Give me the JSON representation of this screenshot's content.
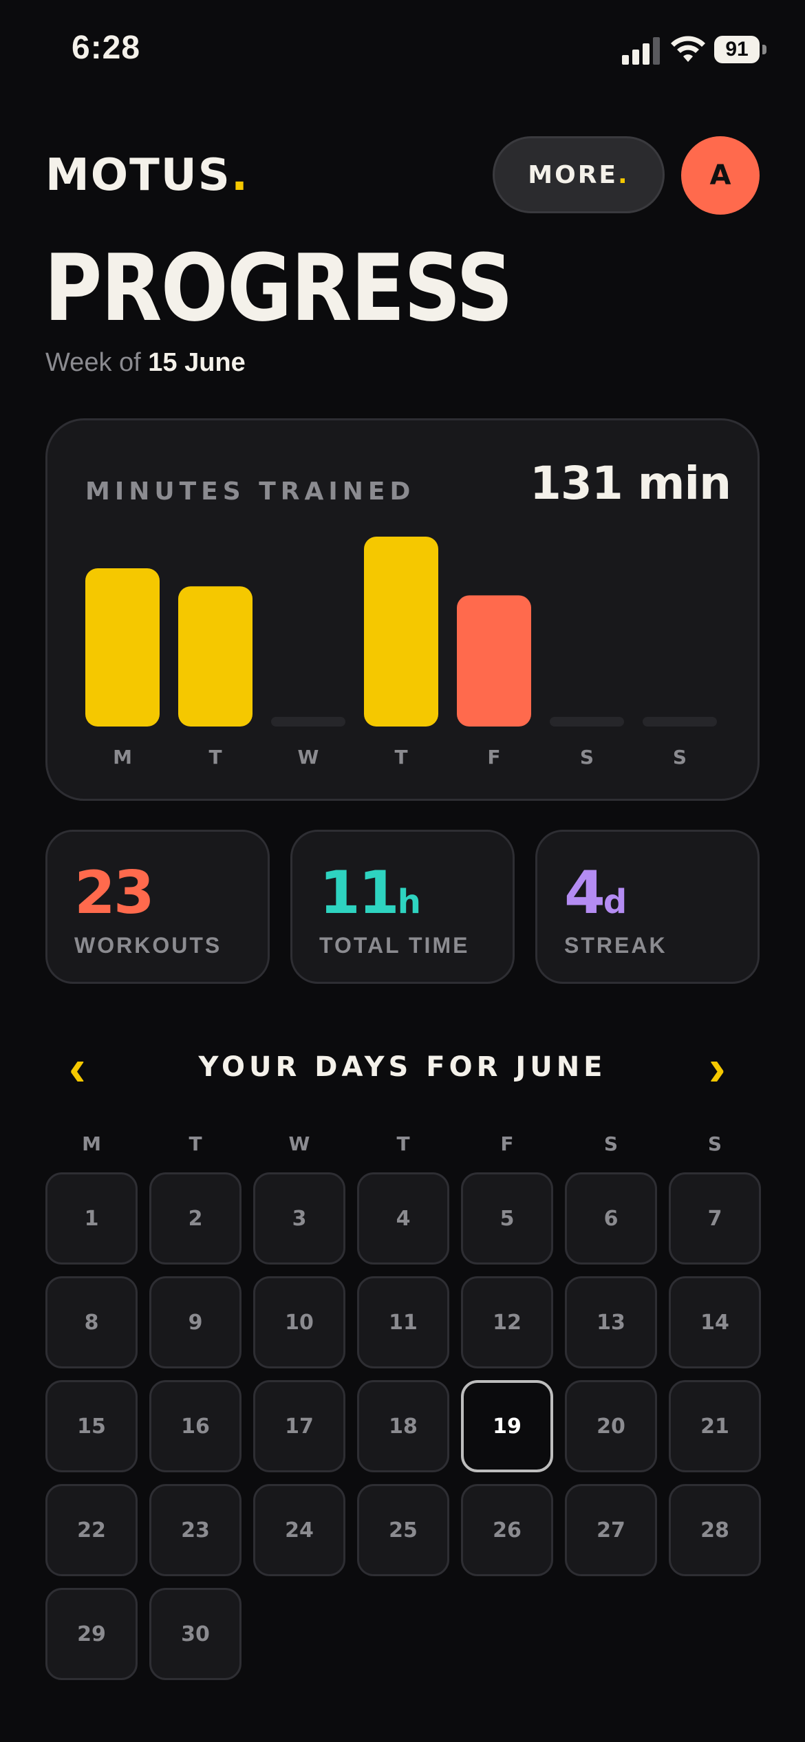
{
  "status_bar": {
    "time": "6:28",
    "battery": "91"
  },
  "header": {
    "brand": "MOTUS",
    "brand_dot": ".",
    "more_label": "MORE",
    "more_dot": ".",
    "avatar_initial": "A"
  },
  "title": "PROGRESS",
  "week": {
    "prefix": "Week of",
    "date": "15 June"
  },
  "chart": {
    "label": "MINUTES TRAINED",
    "total": "131 min",
    "colors": {
      "bar": "#f5c800",
      "highlight": "#ff6a4d",
      "empty": "#26262a"
    }
  },
  "chart_data": {
    "type": "bar",
    "title": "MINUTES TRAINED",
    "categories": [
      "M",
      "T",
      "W",
      "T",
      "F",
      "S",
      "S"
    ],
    "values": [
      35,
      31,
      0,
      42,
      29,
      0,
      0
    ],
    "highlight_index": 4,
    "ylim": [
      0,
      42
    ],
    "grid": false,
    "legend": "none"
  },
  "stats": [
    {
      "value": "23",
      "unit": "",
      "label": "WORKOUTS",
      "color": "#ff6a4d"
    },
    {
      "value": "11",
      "unit": "h",
      "label": "TOTAL TIME",
      "color": "#2ed3c0"
    },
    {
      "value": "4",
      "unit": "d",
      "label": "STREAK",
      "color": "#b48cf2"
    }
  ],
  "calendar": {
    "title": "YOUR DAYS FOR JUNE",
    "prev": "‹",
    "next": "›",
    "weekdays": [
      "M",
      "T",
      "W",
      "T",
      "F",
      "S",
      "S"
    ],
    "days": [
      "1",
      "2",
      "3",
      "4",
      "5",
      "6",
      "7",
      "8",
      "9",
      "10",
      "11",
      "12",
      "13",
      "14",
      "15",
      "16",
      "17",
      "18",
      "19",
      "20",
      "21",
      "22",
      "23",
      "24",
      "25",
      "26",
      "27",
      "28",
      "29",
      "30"
    ],
    "today": "19"
  }
}
